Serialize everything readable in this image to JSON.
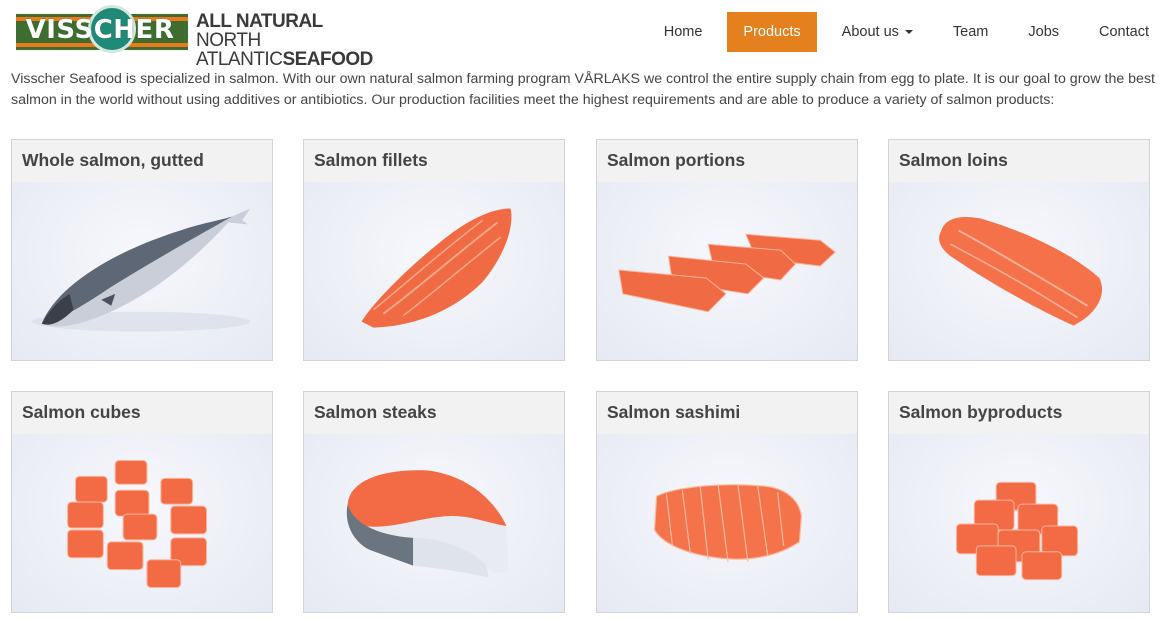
{
  "logo": {
    "brand": "VISSCHER",
    "tagline_line1_bold": "ALL NATURAL",
    "tagline_line1_thin": "NORTH",
    "tagline_line2_thin": "ATLANTIC",
    "tagline_line2_bold": "SEAFOOD"
  },
  "nav": {
    "items": [
      {
        "label": "Home"
      },
      {
        "label": "Products"
      },
      {
        "label": "About us"
      },
      {
        "label": "Team"
      },
      {
        "label": "Jobs"
      },
      {
        "label": "Contact"
      }
    ],
    "active": "Products"
  },
  "intro": "Visscher Seafood is specialized in salmon. With our own natural salmon farming program VÅRLAKS we control the entire supply chain from egg to plate. It is our goal to grow the best salmon in the world without using additives or antibiotics. Our production facilities meet the highest requirements and are able to produce a variety of salmon products:",
  "products": [
    {
      "title": "Whole salmon, gutted"
    },
    {
      "title": "Salmon fillets"
    },
    {
      "title": "Salmon portions"
    },
    {
      "title": "Salmon loins"
    },
    {
      "title": "Salmon cubes"
    },
    {
      "title": "Salmon steaks"
    },
    {
      "title": "Salmon sashimi"
    },
    {
      "title": "Salmon byproducts"
    }
  ],
  "colors": {
    "accent": "#e5801f",
    "logo_green": "#3d6d2f",
    "salmon": "#f26b45"
  }
}
